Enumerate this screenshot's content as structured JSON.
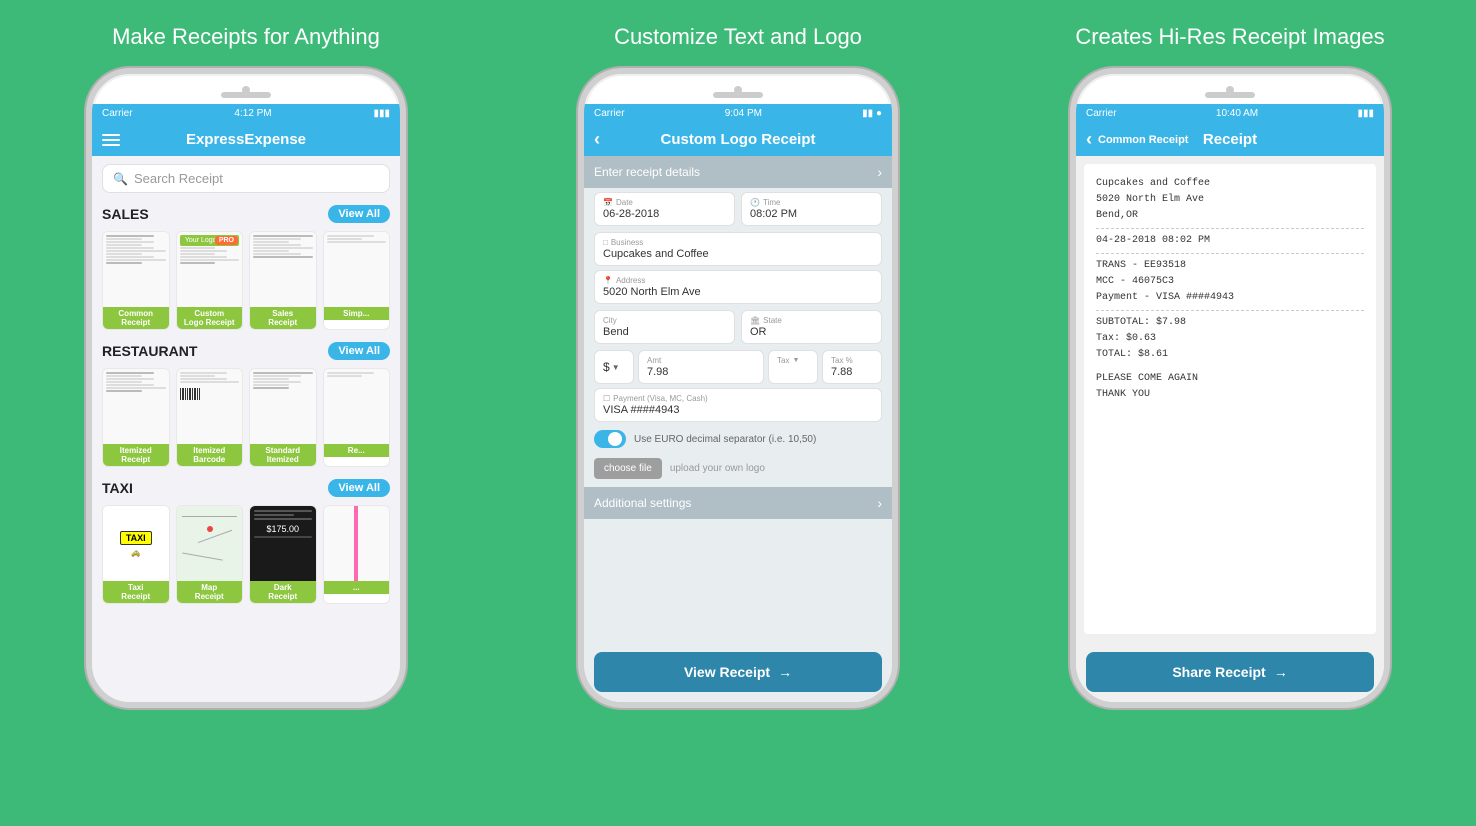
{
  "panels": [
    {
      "id": "panel1",
      "title": "Make Receipts for Anything",
      "phone": {
        "status_bar": {
          "carrier": "Carrier",
          "time": "4:12 PM",
          "battery": "▮▮▮"
        },
        "header_title": "ExpressExpense",
        "search_placeholder": "Search Receipt",
        "sections": [
          {
            "id": "sales",
            "label": "SALES",
            "view_all": "View All",
            "items": [
              {
                "label": "Common\nReceipt"
              },
              {
                "label": "Custom\nLogo Receipt",
                "has_pro": true
              },
              {
                "label": "Sales\nReceipt"
              },
              {
                "label": "Simp..."
              }
            ]
          },
          {
            "id": "restaurant",
            "label": "RESTAURANT",
            "view_all": "View All",
            "items": [
              {
                "label": "Itemized\nReceipt"
              },
              {
                "label": "Itemized\nBarcode"
              },
              {
                "label": "Standard\nItemized"
              },
              {
                "label": "Re..."
              }
            ]
          },
          {
            "id": "taxi",
            "label": "TAXI",
            "view_all": "View All",
            "items": [
              {
                "label": "Taxi\nReceipt",
                "style": "taxi"
              },
              {
                "label": "Map\nReceipt",
                "style": "map"
              },
              {
                "label": "Dark\nReceipt",
                "style": "dark"
              },
              {
                "label": "..."
              }
            ]
          }
        ]
      }
    },
    {
      "id": "panel2",
      "title": "Customize Text and Logo",
      "phone": {
        "status_bar": {
          "carrier": "Carrier",
          "time": "9:04 PM",
          "battery": "▮▮"
        },
        "header_title": "Custom Logo Receipt",
        "enter_receipt_label": "Enter receipt details",
        "date_label": "Date",
        "date_value": "06-28-2018",
        "time_label": "Time",
        "time_value": "08:02 PM",
        "business_label": "Business",
        "business_value": "Cupcakes and Coffee",
        "address_label": "Address",
        "address_value": "5020 North Elm Ave",
        "city_label": "City",
        "city_value": "Bend",
        "state_label": "State",
        "state_value": "OR",
        "currency_symbol": "$",
        "amt_label": "Amt",
        "amt_value": "7.98",
        "tax_label": "Tax",
        "tax_pct_label": "Tax %",
        "tax_value": "7.88",
        "payment_label": "Payment (Visa, MC, Cash)",
        "payment_value": "VISA ####4943",
        "euro_toggle_text": "Use EURO decimal separator (i.e. 10,50)",
        "choose_file_label": "choose file",
        "upload_logo_text": "upload your own logo",
        "additional_settings_label": "Additional settings",
        "view_receipt_btn": "View Receipt",
        "arrow": "→"
      }
    },
    {
      "id": "panel3",
      "title": "Creates Hi-Res Receipt Images",
      "phone": {
        "status_bar": {
          "carrier": "Carrier",
          "time": "10:40 AM",
          "battery": "▮▮▮"
        },
        "back_label": "Common Receipt",
        "header_title": "Receipt",
        "receipt_content": {
          "business": "Cupcakes and Coffee",
          "address": "5020 North Elm Ave",
          "city_state": "Bend,OR",
          "blank_line": "",
          "date_time": "04-28-2018    08:02 PM",
          "blank2": "",
          "trans": "TRANS - EE93518",
          "mcc": "MCC -     46075C3",
          "payment": "Payment - VISA ####4943",
          "blank3": "",
          "subtotal": "SUBTOTAL: $7.98",
          "tax": "Tax:      $0.63",
          "total": "TOTAL:    $8.61",
          "come_again": "PLEASE COME AGAIN",
          "thank_you": "THANK YOU"
        },
        "share_receipt_btn": "Share Receipt",
        "arrow": "→"
      }
    }
  ]
}
